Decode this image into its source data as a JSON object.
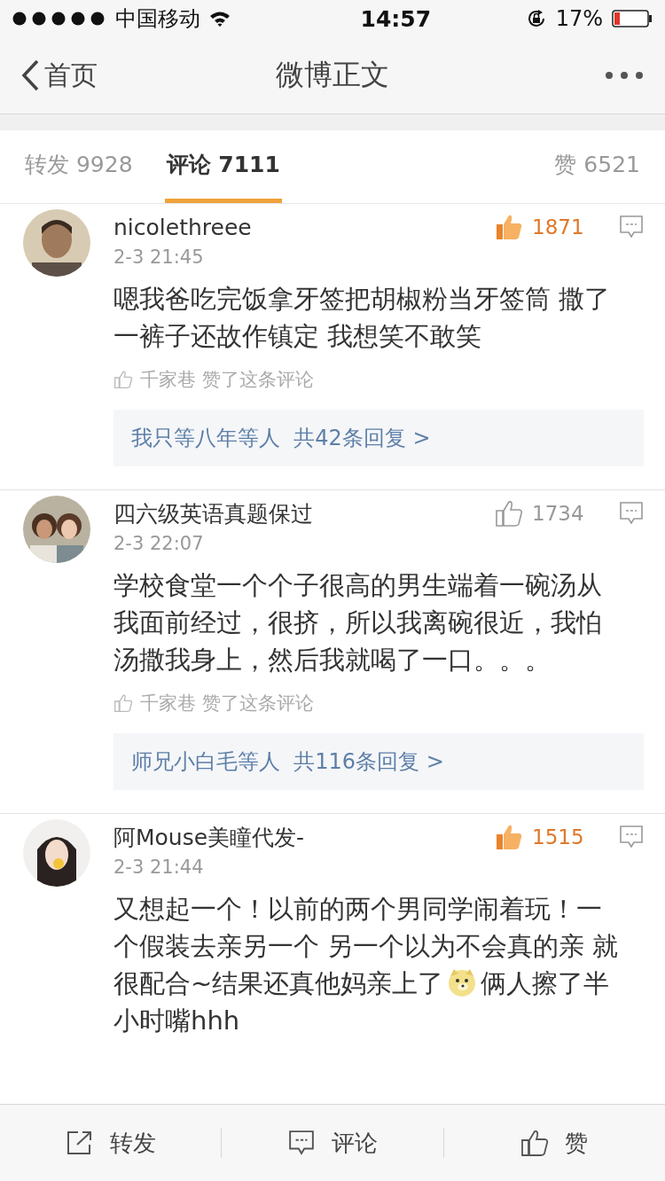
{
  "status_bar": {
    "carrier": "中国移动",
    "time": "14:57",
    "battery": "17%"
  },
  "nav": {
    "back": "首页",
    "title": "微博正文"
  },
  "tabs": [
    {
      "label": "转发",
      "count": "9928",
      "selected": false
    },
    {
      "label": "评论",
      "count": "7111",
      "selected": true
    },
    {
      "label": "赞",
      "count": "6521",
      "selected": false
    }
  ],
  "comments": [
    {
      "user": "nicolethreee",
      "time": "2-3 21:45",
      "liked": true,
      "likes": "1871",
      "segments": [
        {
          "kind": "text",
          "text": "嗯我爸吃完饭拿牙签把胡椒粉当牙签筒 撒了一裤子还故作镇定 我想笑不敢笑"
        }
      ],
      "liked_by": {
        "user": "千家巷",
        "action": "赞了这条评论"
      },
      "replies": {
        "who": "我只等八年等人",
        "summary": "共42条回复 >"
      }
    },
    {
      "user": "四六级英语真题保过",
      "time": "2-3 22:07",
      "liked": false,
      "likes": "1734",
      "segments": [
        {
          "kind": "text",
          "text": "学校食堂一个个子很高的男生端着一碗汤从我面前经过，很挤，所以我离碗很近，我怕汤撒我身上，然后我就喝了一口。。。"
        }
      ],
      "liked_by": {
        "user": "千家巷",
        "action": "赞了这条评论"
      },
      "replies": {
        "who": "师兄小白毛等人",
        "summary": "共116条回复 >"
      }
    },
    {
      "user": "阿Mouse美瞳代发-",
      "time": "2-3 21:44",
      "liked": true,
      "likes": "1515",
      "segments": [
        {
          "kind": "text",
          "text": "又想起一个！以前的两个男同学闹着玩！一个假装去亲另一个 另一个以为不会真的亲 就很配合~结果还真他妈亲上了"
        },
        {
          "kind": "emoji"
        },
        {
          "kind": "text",
          "text": "俩人擦了半小时嘴hhh"
        }
      ]
    }
  ],
  "toolbar": [
    {
      "kind": "repost",
      "label": "转发"
    },
    {
      "kind": "comment",
      "label": "评论"
    },
    {
      "kind": "like",
      "label": "赞"
    }
  ]
}
